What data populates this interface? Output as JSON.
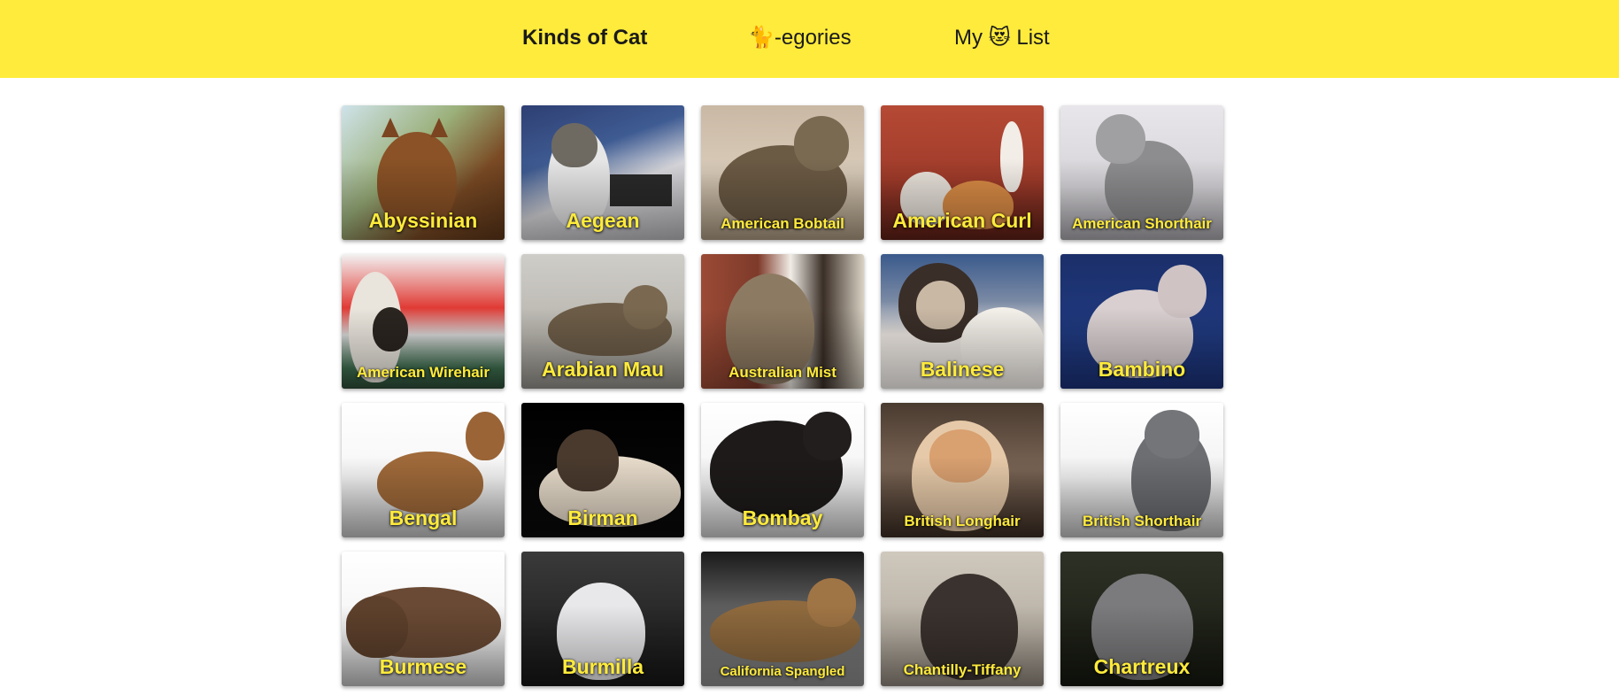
{
  "nav": {
    "brand": "Kinds of Cat",
    "categories": "🐈-egories",
    "my_list": "My 😻 List"
  },
  "colors": {
    "topbar": "#ffeb3b",
    "label": "#ffeb3b"
  },
  "breeds": [
    {
      "name": "Abyssinian"
    },
    {
      "name": "Aegean"
    },
    {
      "name": "American Bobtail"
    },
    {
      "name": "American Curl"
    },
    {
      "name": "American Shorthair"
    },
    {
      "name": "American Wirehair"
    },
    {
      "name": "Arabian Mau"
    },
    {
      "name": "Australian Mist"
    },
    {
      "name": "Balinese"
    },
    {
      "name": "Bambino"
    },
    {
      "name": "Bengal"
    },
    {
      "name": "Birman"
    },
    {
      "name": "Bombay"
    },
    {
      "name": "British Longhair"
    },
    {
      "name": "British Shorthair"
    },
    {
      "name": "Burmese"
    },
    {
      "name": "Burmilla"
    },
    {
      "name": "California Spangled"
    },
    {
      "name": "Chantilly-Tiffany"
    },
    {
      "name": "Chartreux"
    }
  ]
}
